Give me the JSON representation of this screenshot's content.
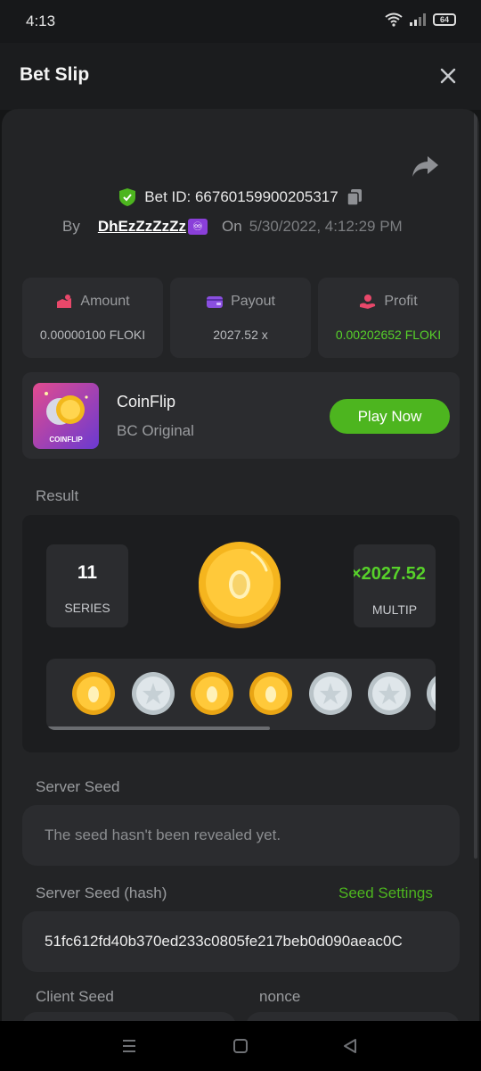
{
  "status_bar": {
    "time": "4:13",
    "battery": "64"
  },
  "header": {
    "title": "Bet Slip"
  },
  "bet": {
    "id_label": "Bet ID: 66760159900205317",
    "by_label": "By",
    "username": "DhEzZzZzZz",
    "badge": "♾",
    "on_label": "On",
    "date": "5/30/2022, 4:12:29 PM"
  },
  "stats": [
    {
      "label": "Amount",
      "value": "0.00000100 FLOKI",
      "icon": "coins-icon"
    },
    {
      "label": "Payout",
      "value": "2027.52 x",
      "icon": "wallet-icon"
    },
    {
      "label": "Profit",
      "value": "0.00202652 FLOKI",
      "icon": "profit-icon"
    }
  ],
  "game": {
    "name": "CoinFlip",
    "subtitle": "BC Original",
    "thumb_label": "COINFLIP",
    "play_label": "Play Now"
  },
  "result": {
    "label": "Result",
    "series_value": "11",
    "series_label": "SERIES",
    "multiplier_value": "×2027.52",
    "multiplier_label": "MULTIP",
    "coins": [
      "gold",
      "silver",
      "gold",
      "gold",
      "silver",
      "silver",
      "silver"
    ]
  },
  "server_seed": {
    "label": "Server Seed",
    "value": "The seed hasn't been revealed yet."
  },
  "server_seed_hash": {
    "label": "Server Seed (hash)",
    "settings_label": "Seed Settings",
    "value": "51fc612fd40b370ed233c0805fe217beb0d090aeac0C"
  },
  "client_seed": {
    "label": "Client Seed"
  },
  "nonce": {
    "label": "nonce"
  },
  "colors": {
    "accent": "#4db51f",
    "profit": "#57d12a",
    "background": "#232426",
    "card": "#2b2c2f"
  }
}
